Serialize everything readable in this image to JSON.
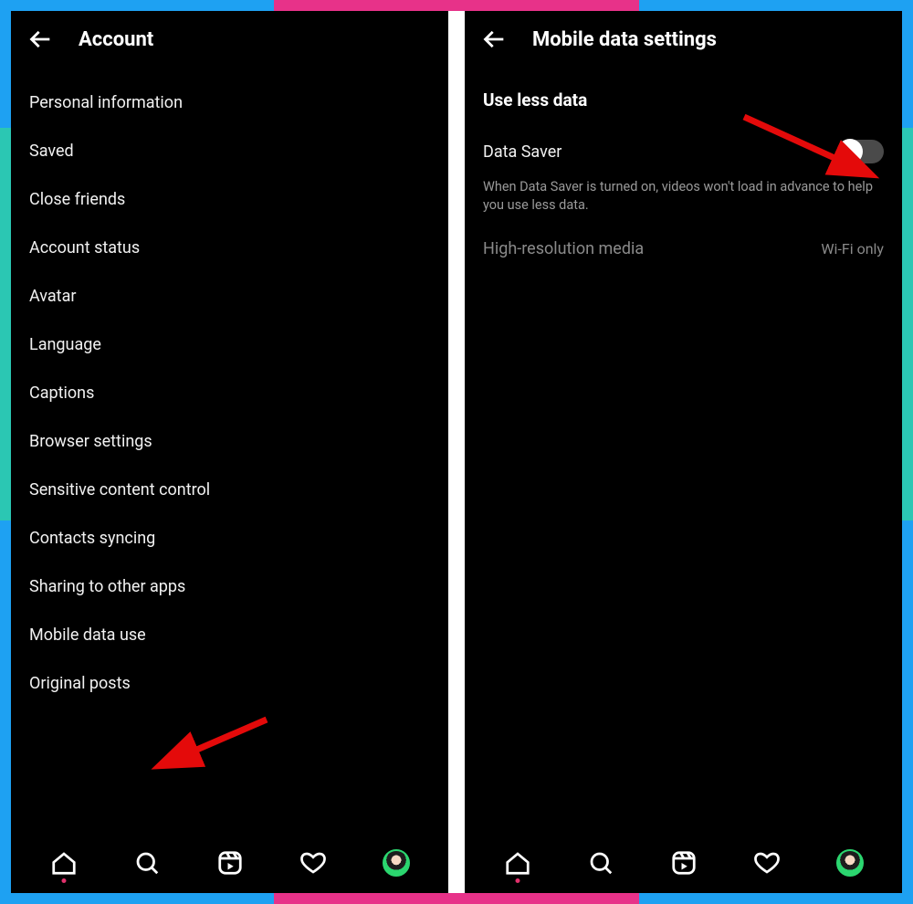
{
  "left": {
    "header_title": "Account",
    "items": [
      "Personal information",
      "Saved",
      "Close friends",
      "Account status",
      "Avatar",
      "Language",
      "Captions",
      "Browser settings",
      "Sensitive content control",
      "Contacts syncing",
      "Sharing to other apps",
      "Mobile data use",
      "Original posts"
    ]
  },
  "right": {
    "header_title": "Mobile data settings",
    "section_title": "Use less data",
    "data_saver_label": "Data Saver",
    "data_saver_on": false,
    "data_saver_description": "When Data Saver is turned on, videos won't load in advance to help you use less data.",
    "high_res_label": "High-resolution media",
    "high_res_value": "Wi-Fi only"
  },
  "nav_icons": [
    "home",
    "search",
    "reels",
    "activity",
    "profile"
  ]
}
